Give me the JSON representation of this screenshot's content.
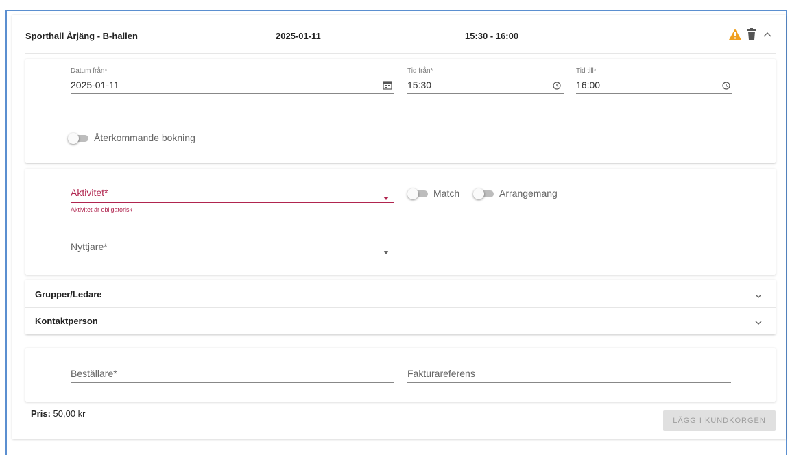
{
  "header": {
    "venue": "Sporthall Årjäng - B-hallen",
    "date": "2025-01-11",
    "time": "15:30 - 16:00",
    "warning_icon_color": "#f0a020"
  },
  "datetime": {
    "date_from_label": "Datum från*",
    "date_from_value": "2025-01-11",
    "time_from_label": "Tid från*",
    "time_from_value": "15:30",
    "time_to_label": "Tid till*",
    "time_to_value": "16:00",
    "recurring_label": "Återkommande bokning"
  },
  "activity": {
    "activity_label": "Aktivitet*",
    "activity_error": "Aktivitet är obligatorisk",
    "match_label": "Match",
    "arrangement_label": "Arrangemang",
    "user_label": "Nyttjare*",
    "error_color": "#b0254f"
  },
  "sections": {
    "groups_label": "Grupper/Ledare",
    "contact_label": "Kontaktperson"
  },
  "billing": {
    "orderer_label": "Beställare*",
    "invoice_ref_label": "Fakturareferens"
  },
  "footer": {
    "price_label": "Pris:",
    "price_value": "50,00 kr",
    "add_to_cart_label": "LÄGG I KUNDKORGEN"
  }
}
